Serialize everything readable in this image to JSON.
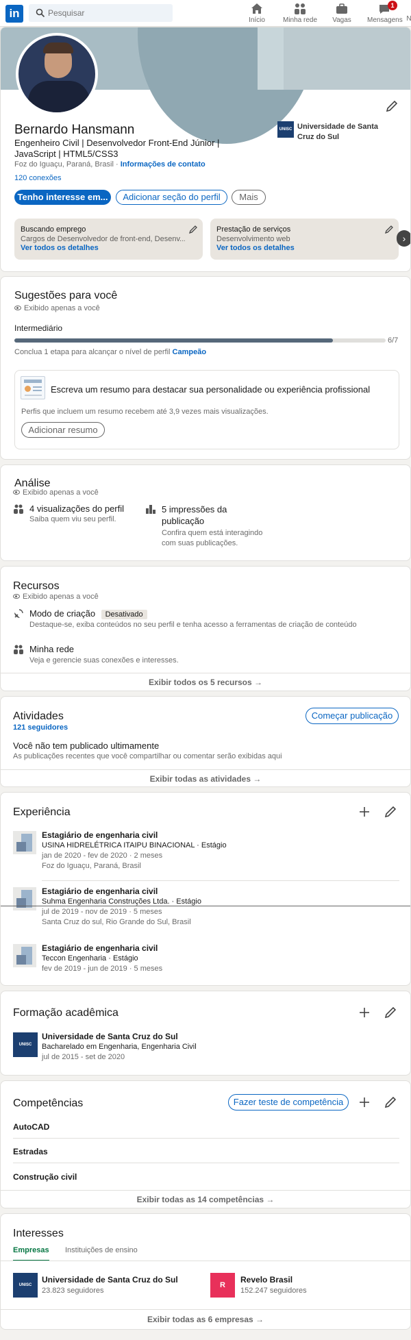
{
  "nav": {
    "logo": "in",
    "search_placeholder": "Pesquisar",
    "items": [
      "Início",
      "Minha rede",
      "Vagas",
      "Mensagens",
      "N"
    ],
    "messages_badge": "1"
  },
  "profile": {
    "name": "Bernardo Hansmann",
    "headline": "Engenheiro Civil | Desenvolvedor Front-End Júnior | JavaScript | HTML5/CSS3",
    "location": "Foz do Iguaçu, Paraná, Brasil ·",
    "contact_link": "Informações de contato",
    "connections": "120 conexões",
    "education_org": "Universidade de Santa Cruz do Sul",
    "logo_text": "UNISC",
    "btn_interest": "Tenho interesse em...",
    "btn_add_section": "Adicionar seção do perfil",
    "btn_more": "Mais",
    "boxes": [
      {
        "title": "Buscando emprego",
        "desc": "Cargos de Desenvolvedor de front-end, Desenv...",
        "link": "Ver todos os detalhes"
      },
      {
        "title": "Prestação de serviços",
        "desc": "Desenvolvimento web",
        "link": "Ver todos os detalhes"
      }
    ]
  },
  "suggestions": {
    "title": "Sugestões para você",
    "private": "Exibido apenas a você",
    "level": "Intermediário",
    "progress_label": "6/7",
    "progress": 0.8571,
    "hint": "Conclua 1 etapa para alcançar o nível de perfil",
    "hint_link": "Campeão",
    "box_title": "Escreva um resumo para destacar sua personalidade ou experiência profissional",
    "box_desc": "Perfis que incluem um resumo recebem até 3,9 vezes mais visualizações.",
    "box_btn": "Adicionar resumo"
  },
  "analytics": {
    "title": "Análise",
    "private": "Exibido apenas a você",
    "items": [
      {
        "title": "4 visualizações do perfil",
        "desc": "Saiba quem viu seu perfil."
      },
      {
        "title": "5 impressões da publicação",
        "desc": "Confira quem está interagindo com suas publicações."
      }
    ]
  },
  "resources": {
    "title": "Recursos",
    "private": "Exibido apenas a você",
    "creator_title": "Modo de criação",
    "creator_badge": "Desativado",
    "creator_desc": "Destaque-se, exiba conteúdos no seu perfil e tenha acesso a ferramentas de criação de conteúdo",
    "network_title": "Minha rede",
    "network_desc": "Veja e gerencie suas conexões e interesses.",
    "footer": "Exibir todos os 5 recursos →"
  },
  "activity": {
    "title": "Atividades",
    "followers": "121 seguidores",
    "btn": "Começar publicação",
    "empty_title": "Você não tem publicado ultimamente",
    "empty_desc": "As publicações recentes que você compartilhar ou comentar serão exibidas aqui",
    "footer": "Exibir todas as atividades →"
  },
  "experience": {
    "title": "Experiência",
    "items": [
      {
        "role": "Estagiário de engenharia civil",
        "company": "USINA HIDRELÉTRICA ITAIPU BINACIONAL · Estágio",
        "dates": "jan de 2020 - fev de 2020 · 2 meses",
        "place": "Foz do Iguaçu, Paraná, Brasil"
      },
      {
        "role": "Estagiário de engenharia civil",
        "company": "Suhma Engenharia Construções Ltda. · Estágio",
        "dates": "jul de 2019 - nov de 2019 · 5 meses",
        "place": "Santa Cruz do sul, Rio Grande do Sul, Brasil"
      },
      {
        "role": "Estagiário de engenharia civil",
        "company": "Teccon Engenharia · Estágio",
        "dates": "fev de 2019 - jun de 2019 · 5 meses",
        "place": ""
      }
    ]
  },
  "education": {
    "title": "Formação acadêmica",
    "school": "Universidade de Santa Cruz do Sul",
    "degree": "Bacharelado em Engenharia, Engenharia Civil",
    "dates": "jul de 2015 - set de 2020",
    "logo_text": "UNISC"
  },
  "skills": {
    "title": "Competências",
    "btn": "Fazer teste de competência",
    "items": [
      "AutoCAD",
      "Estradas",
      "Construção civil"
    ],
    "footer": "Exibir todas as 14 competências →"
  },
  "interests": {
    "title": "Interesses",
    "tabs": [
      "Empresas",
      "Instituições de ensino"
    ],
    "items": [
      {
        "name": "Universidade de Santa Cruz do Sul",
        "followers": "23.823 seguidores",
        "logo": "UNISC"
      },
      {
        "name": "Revelo Brasil",
        "followers": "152.247 seguidores",
        "logo": "R"
      }
    ],
    "footer": "Exibir todas as 6 empresas →"
  },
  "colors": {
    "accent": "#0a66c2",
    "progress": "#56687a",
    "cover": "#a8bcc4",
    "badge": "#cc1016"
  }
}
